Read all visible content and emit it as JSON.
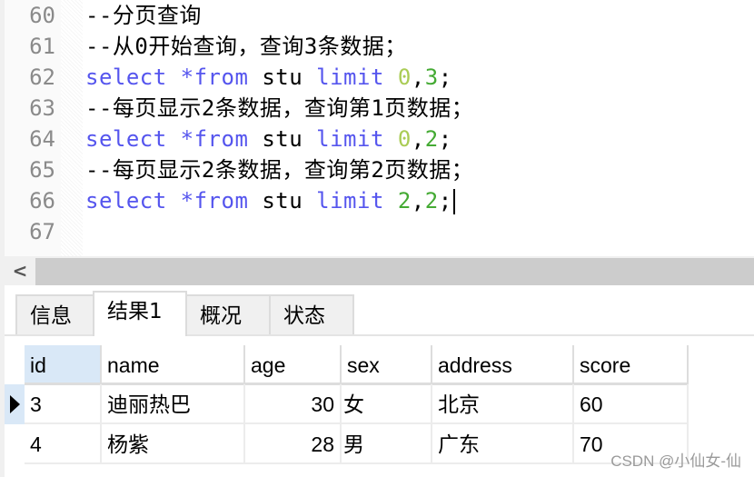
{
  "editor": {
    "lines": [
      {
        "num": "60",
        "segments": [
          {
            "t": "--分页查询",
            "c": "plain"
          }
        ]
      },
      {
        "num": "61",
        "segments": [
          {
            "t": "--从0开始查询，查询3条数据；",
            "c": "plain"
          }
        ]
      },
      {
        "num": "62",
        "segments": [
          {
            "t": "select *from ",
            "c": "kw"
          },
          {
            "t": "stu ",
            "c": "plain"
          },
          {
            "t": "limit ",
            "c": "kw"
          },
          {
            "t": "0",
            "c": "num0"
          },
          {
            "t": ",",
            "c": "plain"
          },
          {
            "t": "3",
            "c": "num"
          },
          {
            "t": ";",
            "c": "plain"
          }
        ]
      },
      {
        "num": "63",
        "segments": [
          {
            "t": "--每页显示2条数据，查询第1页数据；",
            "c": "plain"
          }
        ]
      },
      {
        "num": "64",
        "segments": [
          {
            "t": "select *from ",
            "c": "kw"
          },
          {
            "t": "stu ",
            "c": "plain"
          },
          {
            "t": "limit ",
            "c": "kw"
          },
          {
            "t": "0",
            "c": "num0"
          },
          {
            "t": ",",
            "c": "plain"
          },
          {
            "t": "2",
            "c": "num"
          },
          {
            "t": ";",
            "c": "plain"
          }
        ]
      },
      {
        "num": "65",
        "segments": [
          {
            "t": "--每页显示2条数据，查询第2页数据；",
            "c": "plain"
          }
        ]
      },
      {
        "num": "66",
        "segments": [
          {
            "t": "select *from ",
            "c": "kw"
          },
          {
            "t": "stu ",
            "c": "plain"
          },
          {
            "t": "limit ",
            "c": "kw"
          },
          {
            "t": "2",
            "c": "num"
          },
          {
            "t": ",",
            "c": "plain"
          },
          {
            "t": "2",
            "c": "num"
          },
          {
            "t": ";",
            "c": "plain"
          }
        ],
        "caret": true
      },
      {
        "num": "67",
        "segments": []
      }
    ]
  },
  "scrollbar": {
    "left_arrow_icon": "chevron-left-icon",
    "glyph": "<"
  },
  "tabs": [
    {
      "label": "信息",
      "active": false
    },
    {
      "label": "结果1",
      "active": true
    },
    {
      "label": "概况",
      "active": false
    },
    {
      "label": "状态",
      "active": false
    }
  ],
  "result": {
    "columns": [
      "id",
      "name",
      "age",
      "sex",
      "address",
      "score"
    ],
    "rows": [
      {
        "current": true,
        "cells": [
          "3",
          "迪丽热巴",
          "30",
          "女",
          "北京",
          "60"
        ]
      },
      {
        "current": false,
        "cells": [
          "4",
          "杨紫",
          "28",
          "男",
          "广东",
          "70"
        ]
      }
    ]
  },
  "watermark": "CSDN @小仙女-仙"
}
